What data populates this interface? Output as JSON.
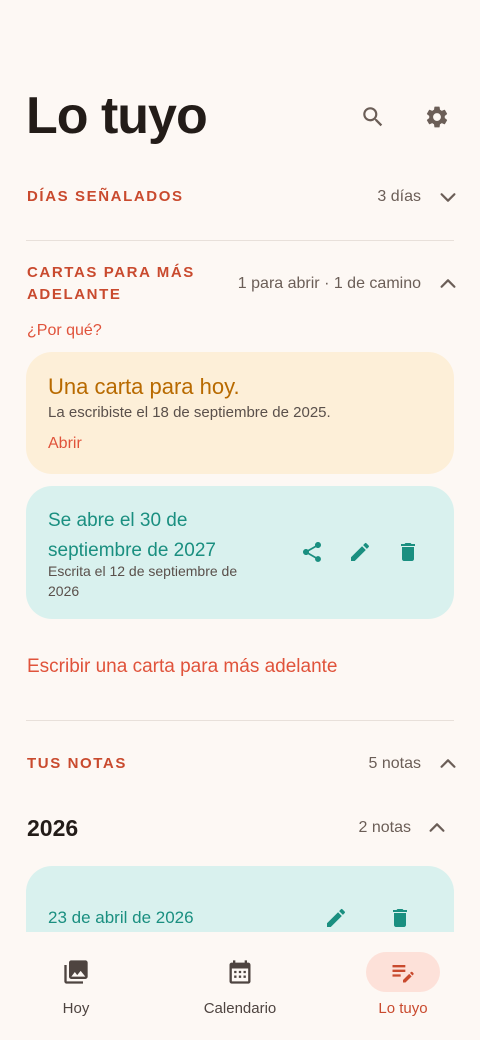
{
  "header": {
    "title": "Lo tuyo",
    "search_icon": "search-icon",
    "settings_icon": "gear-icon"
  },
  "dias": {
    "label": "DÍAS SEÑALADOS",
    "meta": "3 días"
  },
  "cartas": {
    "label_line1": "CARTAS PARA MÁS",
    "label_line2": "ADELANTE",
    "meta": "1 para abrir · 1 de camino",
    "why_link": "¿Por qué?",
    "open_card": {
      "title": "Una carta para hoy.",
      "subtitle": "La escribiste el 18 de septiembre de 2025.",
      "action": "Abrir"
    },
    "future_card": {
      "title_line1": "Se abre el 30 de",
      "title_line2": "septiembre de 2027",
      "sub_line1": "Escrita el 12 de septiembre de",
      "sub_line2": "2026"
    },
    "write_link": "Escribir una carta para más adelante"
  },
  "notas": {
    "label": "TUS NOTAS",
    "meta": "5 notas",
    "year": "2026",
    "year_meta": "2 notas",
    "note_date": "23 de abril de 2026"
  },
  "nav": {
    "items": [
      {
        "label": "Hoy",
        "icon": "photo-icon",
        "active": false
      },
      {
        "label": "Calendario",
        "icon": "calendar-icon",
        "active": false
      },
      {
        "label": "Lo tuyo",
        "icon": "notes-edit-icon",
        "active": true
      }
    ]
  },
  "colors": {
    "accent": "#e0533b",
    "section": "#c94a2e",
    "teal": "#1a8f80",
    "amber": "#b86a00"
  }
}
